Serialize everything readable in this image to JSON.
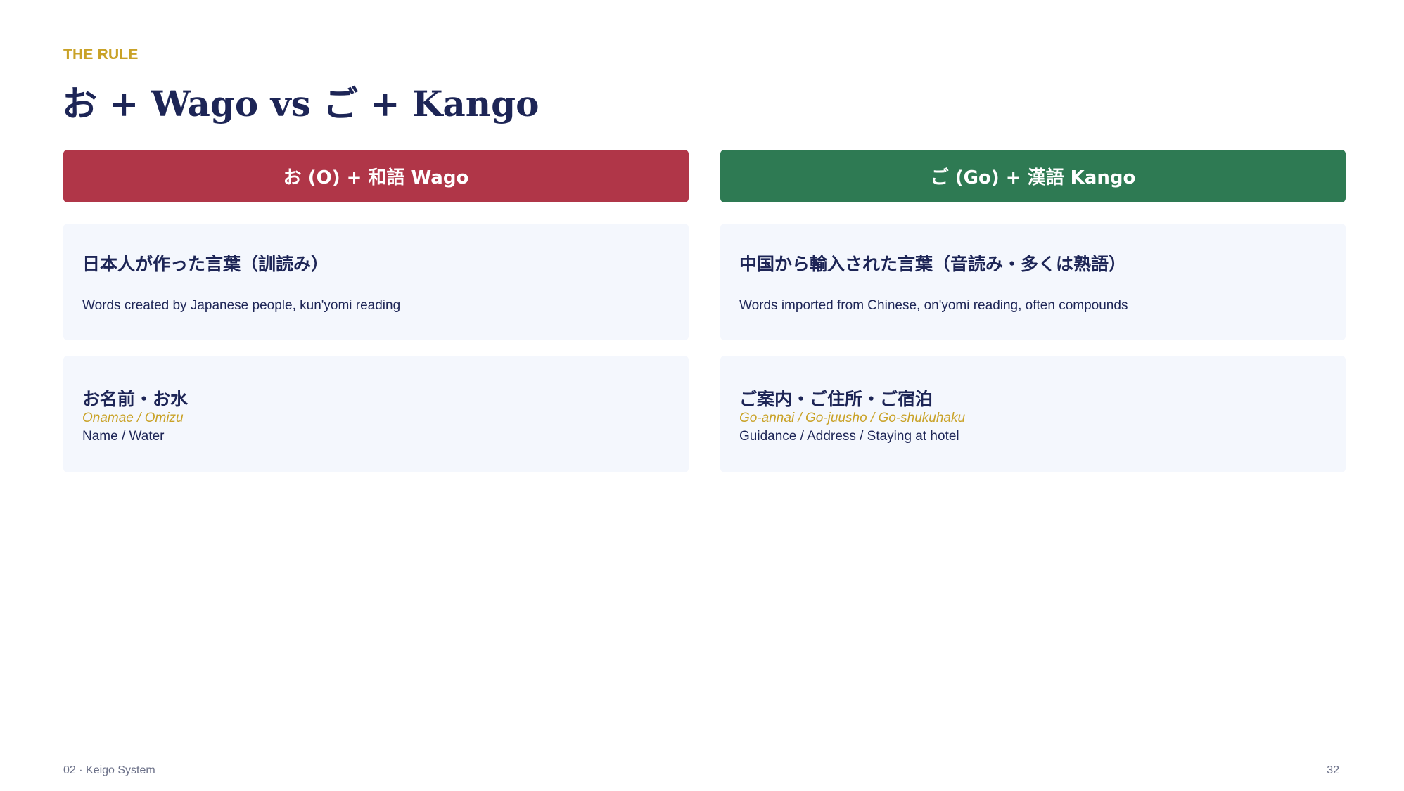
{
  "eyebrow": "THE RULE",
  "title": "お + Wago vs ご + Kango",
  "left": {
    "header": "お (O) + 和語 Wago",
    "definition": {
      "title": "日本人が作った言葉（訓読み）",
      "description": "Words created by Japanese people, kun'yomi reading"
    },
    "example": {
      "japanese": "お名前・お水",
      "romaji": "Onamae / Omizu",
      "english": "Name / Water"
    }
  },
  "right": {
    "header": "ご (Go) + 漢語 Kango",
    "definition": {
      "title": "中国から輸入された言葉（音読み・多くは熟語）",
      "description": "Words imported from Chinese, on'yomi reading, often compounds"
    },
    "example": {
      "japanese": "ご案内・ご住所・ご宿泊",
      "romaji": "Go-annai / Go-juusho / Go-shukuhaku",
      "english": "Guidance / Address / Staying at hotel"
    }
  },
  "footer": {
    "section": "02 · Keigo System",
    "page_number": "32"
  },
  "colors": {
    "accent_gold": "#c9a227",
    "navy": "#1d2556",
    "wago_red": "#b03648",
    "kango_green": "#2e7a53",
    "card_bg": "#f4f7fd"
  }
}
